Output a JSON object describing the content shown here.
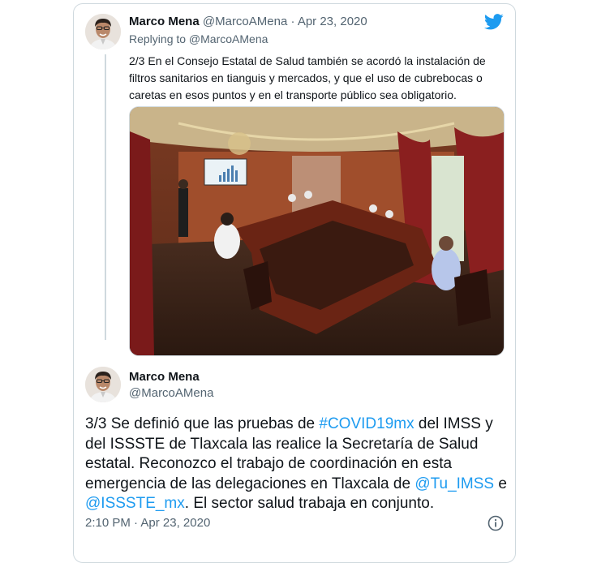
{
  "tweet1": {
    "name": "Marco Mena",
    "handle": "@MarcoAMena",
    "separator": "·",
    "date": "Apr 23, 2020",
    "replying_to": "Replying to @MarcoAMena",
    "text": "2/3 En el Consejo Estatal de Salud también se acordó la instalación de filtros sanitarios en tianguis y mercados, y que el uso de cubrebocas o caretas en esos puntos y en el transporte público sea obligatorio."
  },
  "tweet2": {
    "name": "Marco Mena",
    "handle": "@MarcoAMena",
    "text_parts": {
      "p1": "3/3 Se definió que las pruebas de ",
      "hashtag": "#COVID19mx",
      "p2": " del IMSS y del ISSSTE de Tlaxcala las realice la Secretaría de Salud estatal. Reconozco el trabajo de coordinación en esta emergencia de las delegaciones en Tlaxcala de ",
      "mention1": "@Tu_IMSS",
      "p3": " e ",
      "mention2": "@ISSSTE_mx",
      "p4": ". El sector salud trabaja en conjunto."
    },
    "time": "2:10 PM",
    "separator": "·",
    "date": "Apr 23, 2020"
  },
  "icons": {
    "brand": "twitter-bird-icon",
    "info": "info-icon"
  },
  "colors": {
    "link": "#1d9bf0",
    "secondary_text": "#536471",
    "border": "#cfd9de"
  }
}
